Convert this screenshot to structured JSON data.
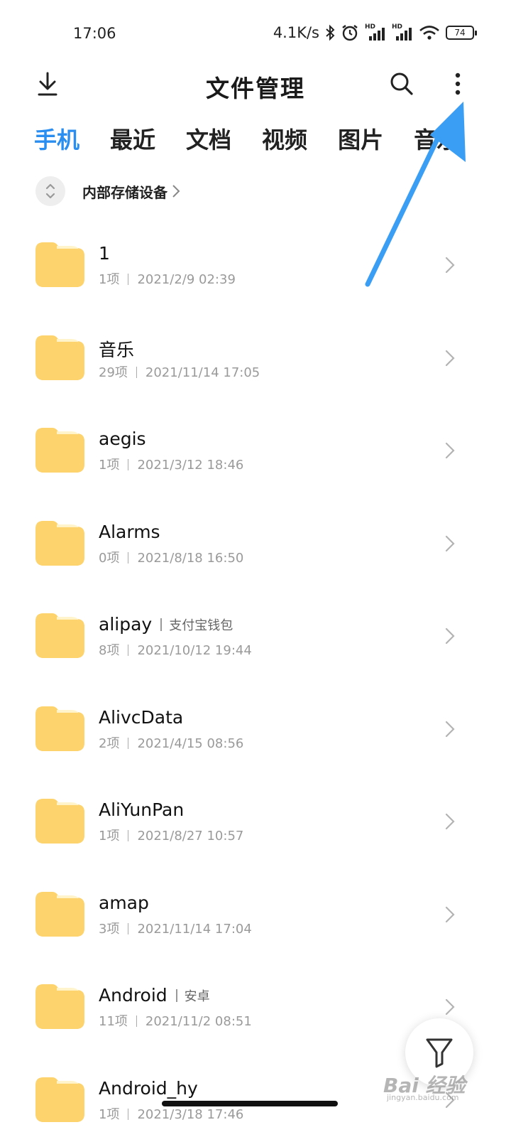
{
  "status_bar": {
    "time": "17:06",
    "net_speed": "4.1K/s",
    "battery": "74",
    "signal_label": "HD"
  },
  "header": {
    "title": "文件管理"
  },
  "tabs": [
    {
      "label": "手机",
      "active": true
    },
    {
      "label": "最近",
      "active": false
    },
    {
      "label": "文档",
      "active": false
    },
    {
      "label": "视频",
      "active": false
    },
    {
      "label": "图片",
      "active": false
    },
    {
      "label": "音乐",
      "active": false
    }
  ],
  "breadcrumb": {
    "label": "内部存储设备"
  },
  "files": [
    {
      "name": "1",
      "alias": "",
      "count": "1项",
      "date": "2021/2/9 02:39"
    },
    {
      "name": "音乐",
      "alias": "",
      "count": "29项",
      "date": "2021/11/14 17:05"
    },
    {
      "name": "aegis",
      "alias": "",
      "count": "1项",
      "date": "2021/3/12 18:46"
    },
    {
      "name": "Alarms",
      "alias": "",
      "count": "0项",
      "date": "2021/8/18 16:50"
    },
    {
      "name": "alipay",
      "alias": "支付宝钱包",
      "count": "8项",
      "date": "2021/10/12 19:44"
    },
    {
      "name": "AlivcData",
      "alias": "",
      "count": "2项",
      "date": "2021/4/15 08:56"
    },
    {
      "name": "AliYunPan",
      "alias": "",
      "count": "1项",
      "date": "2021/8/27 10:57"
    },
    {
      "name": "amap",
      "alias": "",
      "count": "3项",
      "date": "2021/11/14 17:04"
    },
    {
      "name": "Android",
      "alias": "安卓",
      "count": "11项",
      "date": "2021/11/2 08:51"
    },
    {
      "name": "Android_hy",
      "alias": "",
      "count": "1项",
      "date": "2021/3/18 17:46"
    }
  ],
  "watermark": {
    "text": "Bai 经验",
    "sub": "jingyan.baidu.com"
  },
  "colors": {
    "accent": "#2a8ef0",
    "folder": "#fdd36e",
    "annotation_arrow": "#3b9ef5"
  },
  "icons": {
    "download": "download-icon",
    "search": "search-icon",
    "more": "more-vertical-icon",
    "folder": "folder-icon",
    "chevron": "chevron-right-icon",
    "filter": "filter-icon",
    "sort": "sort-icon"
  }
}
